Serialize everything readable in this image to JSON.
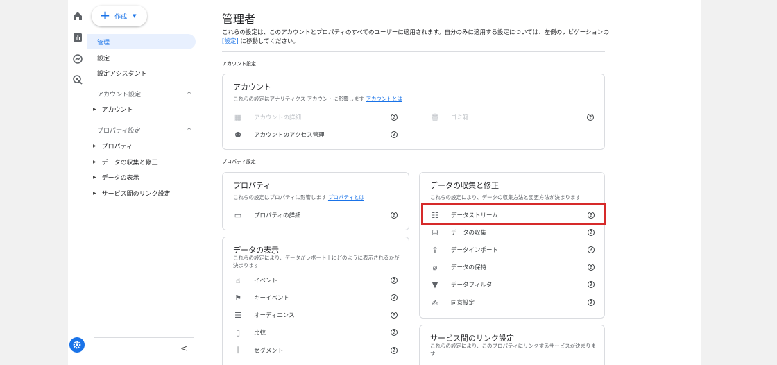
{
  "create_button": {
    "label": "作成"
  },
  "nav": {
    "items": [
      {
        "label": "管理",
        "active": true
      },
      {
        "label": "設定"
      },
      {
        "label": "設定アシスタント"
      }
    ],
    "account_section": {
      "label": "アカウント設定",
      "children": [
        "アカウント"
      ]
    },
    "property_section": {
      "label": "プロパティ設定",
      "children": [
        "プロパティ",
        "データの収集と修正",
        "データの表示",
        "サービス間のリンク設定"
      ]
    }
  },
  "main": {
    "title": "管理者",
    "desc_before": "これらの設定は、このアカウントとプロパティのすべてのユーザーに適用されます。自分のみに適用する設定については、左側のナビゲーションの",
    "desc_link": "[設定]",
    "desc_after": " に移動してください。",
    "account_label": "アカウント設定",
    "property_label": "プロパティ設定",
    "account_card": {
      "title": "アカウント",
      "desc": "これらの設定はアナリティクス アカウントに影響します ",
      "link": "アカウントとは",
      "rows_left": [
        {
          "icon": "building-icon",
          "label": "アカウントの詳細",
          "disabled": true
        },
        {
          "icon": "people-icon",
          "label": "アカウントのアクセス管理",
          "disabled": false
        }
      ],
      "rows_right": [
        {
          "icon": "trash-icon",
          "label": "ゴミ箱",
          "disabled": true
        }
      ]
    },
    "property_card": {
      "title": "プロパティ",
      "desc": "これらの設定はプロパティに影響します ",
      "link": "プロパティとは",
      "rows": [
        {
          "icon": "details-icon",
          "label": "プロパティの詳細"
        }
      ]
    },
    "data_display_card": {
      "title": "データの表示",
      "desc": "これらの設定により、データがレポート上にどのように表示されるかが決まります",
      "rows": [
        {
          "icon": "touch-icon",
          "label": "イベント"
        },
        {
          "icon": "flag-icon",
          "label": "キーイベント"
        },
        {
          "icon": "audience-icon",
          "label": "オーディエンス"
        },
        {
          "icon": "compare-icon",
          "label": "比較"
        },
        {
          "icon": "segment-icon",
          "label": "セグメント"
        }
      ]
    },
    "data_collection_card": {
      "title": "データの収集と修正",
      "desc": "これらの設定により、データの収集方法と変更方法が決まります",
      "rows": [
        {
          "icon": "stream-icon",
          "label": "データストリーム"
        },
        {
          "icon": "database-icon",
          "label": "データの収集"
        },
        {
          "icon": "upload-icon",
          "label": "データインポート"
        },
        {
          "icon": "retention-icon",
          "label": "データの保持"
        },
        {
          "icon": "filter-icon",
          "label": "データフィルタ"
        },
        {
          "icon": "consent-icon",
          "label": "同意設定"
        }
      ]
    },
    "link_card": {
      "title": "サービス間のリンク設定",
      "desc": "これらの設定により、このプロパティにリンクするサービスが決まります"
    }
  },
  "colors": {
    "accent": "#1a73e8",
    "highlight": "#d62a2a"
  }
}
